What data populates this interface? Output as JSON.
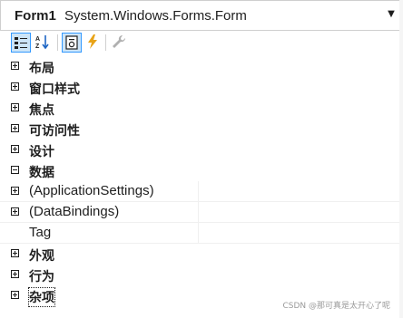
{
  "selector": {
    "object_name": "Form1",
    "object_type": "System.Windows.Forms.Form",
    "dropdown_icon": "chevron-down-icon"
  },
  "toolbar": {
    "buttons": [
      {
        "name": "categorized-icon",
        "active": true
      },
      {
        "name": "alphabetical-icon",
        "active": false
      },
      {
        "name": "properties-icon",
        "active": true
      },
      {
        "name": "events-icon",
        "active": false
      },
      {
        "name": "property-pages-icon",
        "active": false
      }
    ]
  },
  "grid": {
    "rows": [
      {
        "kind": "category",
        "label": "布局",
        "expanded": false
      },
      {
        "kind": "category",
        "label": "窗口样式",
        "expanded": false
      },
      {
        "kind": "category",
        "label": "焦点",
        "expanded": false
      },
      {
        "kind": "category",
        "label": "可访问性",
        "expanded": false
      },
      {
        "kind": "category",
        "label": "设计",
        "expanded": false
      },
      {
        "kind": "category",
        "label": "数据",
        "expanded": true
      },
      {
        "kind": "property",
        "label": "(ApplicationSettings)",
        "value": "",
        "expandable": true
      },
      {
        "kind": "property",
        "label": "(DataBindings)",
        "value": "",
        "expandable": true
      },
      {
        "kind": "property",
        "label": "Tag",
        "value": "",
        "expandable": false
      },
      {
        "kind": "category",
        "label": "外观",
        "expanded": false
      },
      {
        "kind": "category",
        "label": "行为",
        "expanded": false
      },
      {
        "kind": "category",
        "label": "杂项",
        "expanded": false,
        "focused": true
      }
    ]
  },
  "watermark": "CSDN @那可真是太开心了呢",
  "colors": {
    "accent": "#3399ff",
    "active_bg": "#cce4f7",
    "event_bolt": "#e8a317",
    "text": "#1e1e1e"
  }
}
